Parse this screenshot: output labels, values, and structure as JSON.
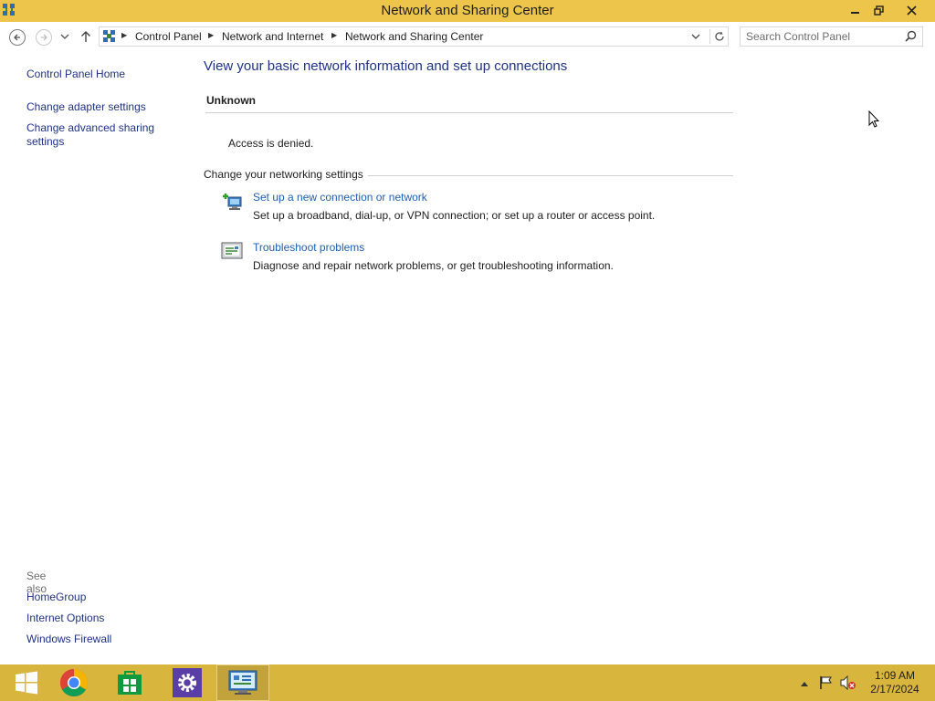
{
  "window": {
    "title": "Network and Sharing Center",
    "min_label": "—",
    "max_label": "❐",
    "close_label": "✕"
  },
  "nav": {
    "breadcrumbs": [
      "Control Panel",
      "Network and Internet",
      "Network and Sharing Center"
    ],
    "search_placeholder": "Search Control Panel"
  },
  "sidebar": {
    "home": "Control Panel Home",
    "adapter": "Change adapter settings",
    "sharing": "Change advanced sharing settings",
    "see_also": "See also",
    "see_also_items": [
      "HomeGroup",
      "Internet Options",
      "Windows Firewall"
    ]
  },
  "main": {
    "title": "View your basic network information and set up connections",
    "network_name": "Unknown",
    "status": "Access is denied.",
    "section_header": "Change your networking settings",
    "tasks": [
      {
        "link": "Set up a new connection or network",
        "desc": "Set up a broadband, dial-up, or VPN connection; or set up a router or access point.",
        "icon": "new-connection-icon"
      },
      {
        "link": "Troubleshoot problems",
        "desc": "Diagnose and repair network problems, or get troubleshooting information.",
        "icon": "troubleshoot-icon"
      }
    ]
  },
  "taskbar": {
    "time": "1:09 AM",
    "date": "2/17/2024",
    "pinned": [
      "start-icon",
      "chrome-icon",
      "store-icon",
      "settings-icon",
      "network-center-icon"
    ]
  },
  "colors": {
    "titlebar": "#ecc54a",
    "taskbar": "#d8b53c",
    "link": "#1e3287"
  }
}
